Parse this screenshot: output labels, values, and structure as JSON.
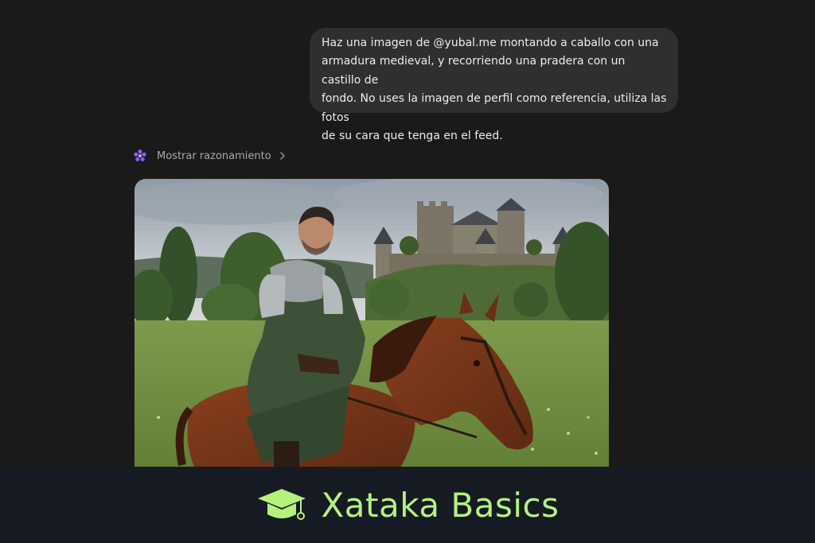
{
  "user_message": {
    "lines": [
      "Haz una imagen de @yubal.me montando a caballo con una",
      "armadura medieval, y recorriendo una pradera con un castillo de",
      "fondo. No uses la imagen de perfil como referencia, utiliza las fotos",
      "de su cara que tenga en el feed."
    ]
  },
  "assistant": {
    "reasoning_label": "Mostrar razonamiento",
    "reasoning_icon": "flower-sparkle-icon",
    "reasoning_chevron": "chevron-right-icon"
  },
  "banner": {
    "brand": "Xataka Basics",
    "icon": "graduation-cap-icon"
  },
  "colors": {
    "page_bg": "#1a1a1a",
    "bubble_bg": "#2f2f2f",
    "banner_bg": "#161b23",
    "brand": "#b5f27c",
    "reasoning_icon": "#8e5bf2"
  }
}
